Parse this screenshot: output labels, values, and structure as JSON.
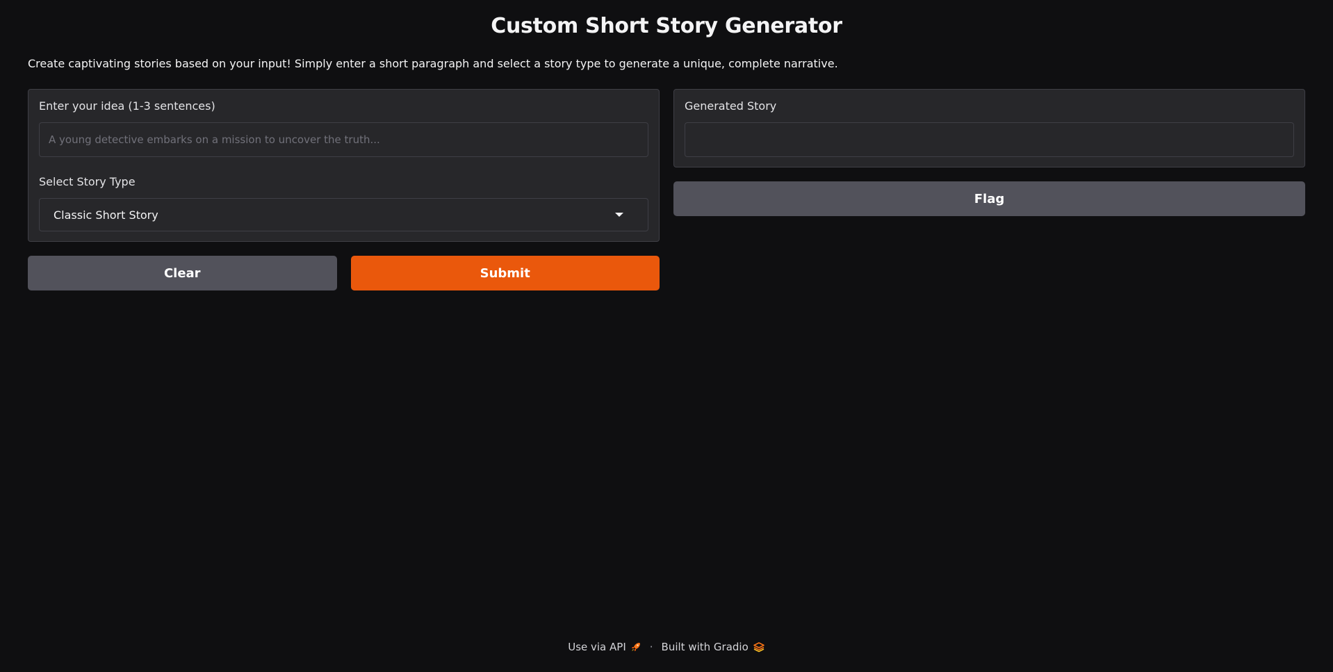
{
  "header": {
    "title": "Custom Short Story Generator",
    "description": "Create captivating stories based on your input! Simply enter a short paragraph and select a story type to generate a unique, complete narrative."
  },
  "input_panel": {
    "idea_label": "Enter your idea (1-3 sentences)",
    "idea_value": "",
    "idea_placeholder": "A young detective embarks on a mission to uncover the truth...",
    "story_type_label": "Select Story Type",
    "story_type_selected": "Classic Short Story"
  },
  "actions": {
    "clear_label": "Clear",
    "submit_label": "Submit"
  },
  "output_panel": {
    "label": "Generated Story",
    "value": "",
    "flag_label": "Flag"
  },
  "footer": {
    "api_label": "Use via API",
    "separator": "·",
    "built_with_label": "Built with Gradio"
  },
  "colors": {
    "background": "#0f0f11",
    "panel": "#27272a",
    "primary_button": "#ea580c",
    "secondary_button": "#52525b"
  },
  "icons": {
    "api": "rocket-icon",
    "gradio": "gradio-logo-icon",
    "dropdown": "chevron-down-icon"
  }
}
